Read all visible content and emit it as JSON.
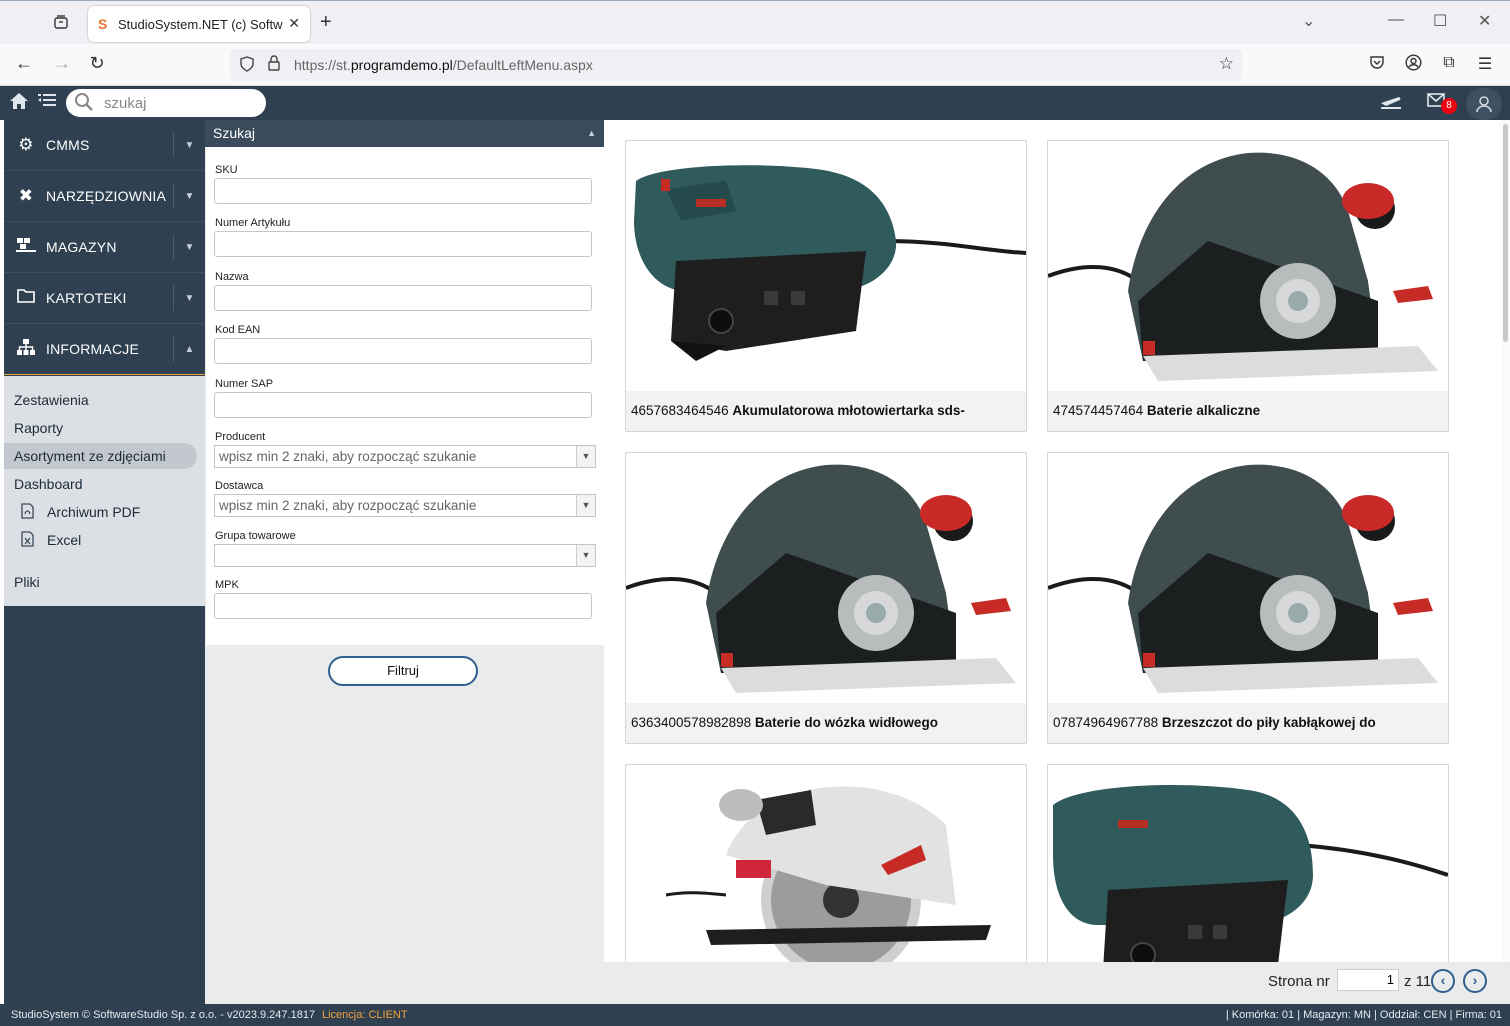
{
  "browser": {
    "tab_title": "StudioSystem.NET (c) Software",
    "url_prefix": "https://st.",
    "url_domain": "programdemo.pl",
    "url_path": "/DefaultLeftMenu.aspx"
  },
  "app": {
    "search_placeholder": "szukaj",
    "mail_count": "8"
  },
  "sidebar": {
    "items": [
      {
        "label": "CMMS",
        "icon": "gears-icon"
      },
      {
        "label": "NARZĘDZIOWNIA",
        "icon": "tools-icon"
      },
      {
        "label": "MAGAZYN",
        "icon": "warehouse-icon"
      },
      {
        "label": "KARTOTEKI",
        "icon": "folder-icon"
      },
      {
        "label": "INFORMACJE",
        "icon": "sitemap-icon"
      }
    ],
    "sub": [
      {
        "label": "Zestawienia"
      },
      {
        "label": "Raporty"
      },
      {
        "label": "Asortyment ze zdjęciami"
      },
      {
        "label": "Dashboard"
      },
      {
        "label": "Archiwum PDF"
      },
      {
        "label": "Excel"
      },
      {
        "label": "Pliki"
      }
    ]
  },
  "panel": {
    "title": "Szukaj",
    "fields": {
      "sku": "SKU",
      "article": "Numer Artykułu",
      "name": "Nazwa",
      "ean": "Kod EAN",
      "sap": "Numer SAP",
      "producer": "Producent",
      "supplier": "Dostawca",
      "group": "Grupa towarowe",
      "mpk": "MPK"
    },
    "select_placeholder": "wpisz min 2 znaki, aby rozpocząć szukanie",
    "filter_button": "Filtruj"
  },
  "products": [
    {
      "code": "4657683464546",
      "name": "Akumulatorowa młotowiertarka sds-",
      "image": "jigsaw"
    },
    {
      "code": "474574457464",
      "name": "Baterie alkaliczne",
      "image": "planer"
    },
    {
      "code": "6363400578982898",
      "name": "Baterie do wózka widłowego",
      "image": "planer"
    },
    {
      "code": "07874964967788",
      "name": "Brzeszczot do piły kabłąkowej do",
      "image": "planer"
    },
    {
      "code": "",
      "name": "",
      "image": "circular-saw"
    },
    {
      "code": "",
      "name": "",
      "image": "jigsaw"
    }
  ],
  "pager": {
    "label": "Strona nr",
    "current": "1",
    "of": "z 11"
  },
  "footer": {
    "copyright": "StudioSystem © SoftwareStudio Sp. z o.o. - v2023.9.247.1817",
    "license": "Licencja: CLIENT",
    "status": "| Komórka: 01 | Magazyn: MN | Oddział: CEN | Firma: 01"
  },
  "colors": {
    "header": "#2f4050",
    "accent": "#e8a33a",
    "button_border": "#2f5f8f"
  }
}
